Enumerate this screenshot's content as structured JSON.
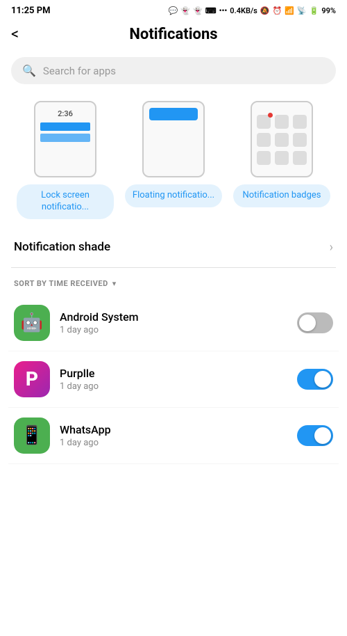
{
  "statusBar": {
    "time": "11:25 PM",
    "network": "0.4KB/s",
    "battery": "99%"
  },
  "header": {
    "backLabel": "<",
    "title": "Notifications"
  },
  "search": {
    "placeholder": "Search for apps"
  },
  "notifTypes": [
    {
      "id": "lock-screen",
      "label": "Lock screen notificatio..."
    },
    {
      "id": "floating",
      "label": "Floating notificatio..."
    },
    {
      "id": "badges",
      "label": "Notification badges"
    }
  ],
  "notificationShade": {
    "label": "Notification shade"
  },
  "sortHeader": {
    "label": "SORT BY TIME RECEIVED"
  },
  "apps": [
    {
      "id": "android-system",
      "name": "Android System",
      "time": "1 day ago",
      "toggleOn": false,
      "iconType": "android"
    },
    {
      "id": "purplle",
      "name": "Purplle",
      "time": "1 day ago",
      "toggleOn": true,
      "iconType": "purplle"
    },
    {
      "id": "whatsapp",
      "name": "WhatsApp",
      "time": "1 day ago",
      "toggleOn": true,
      "iconType": "whatsapp"
    }
  ]
}
